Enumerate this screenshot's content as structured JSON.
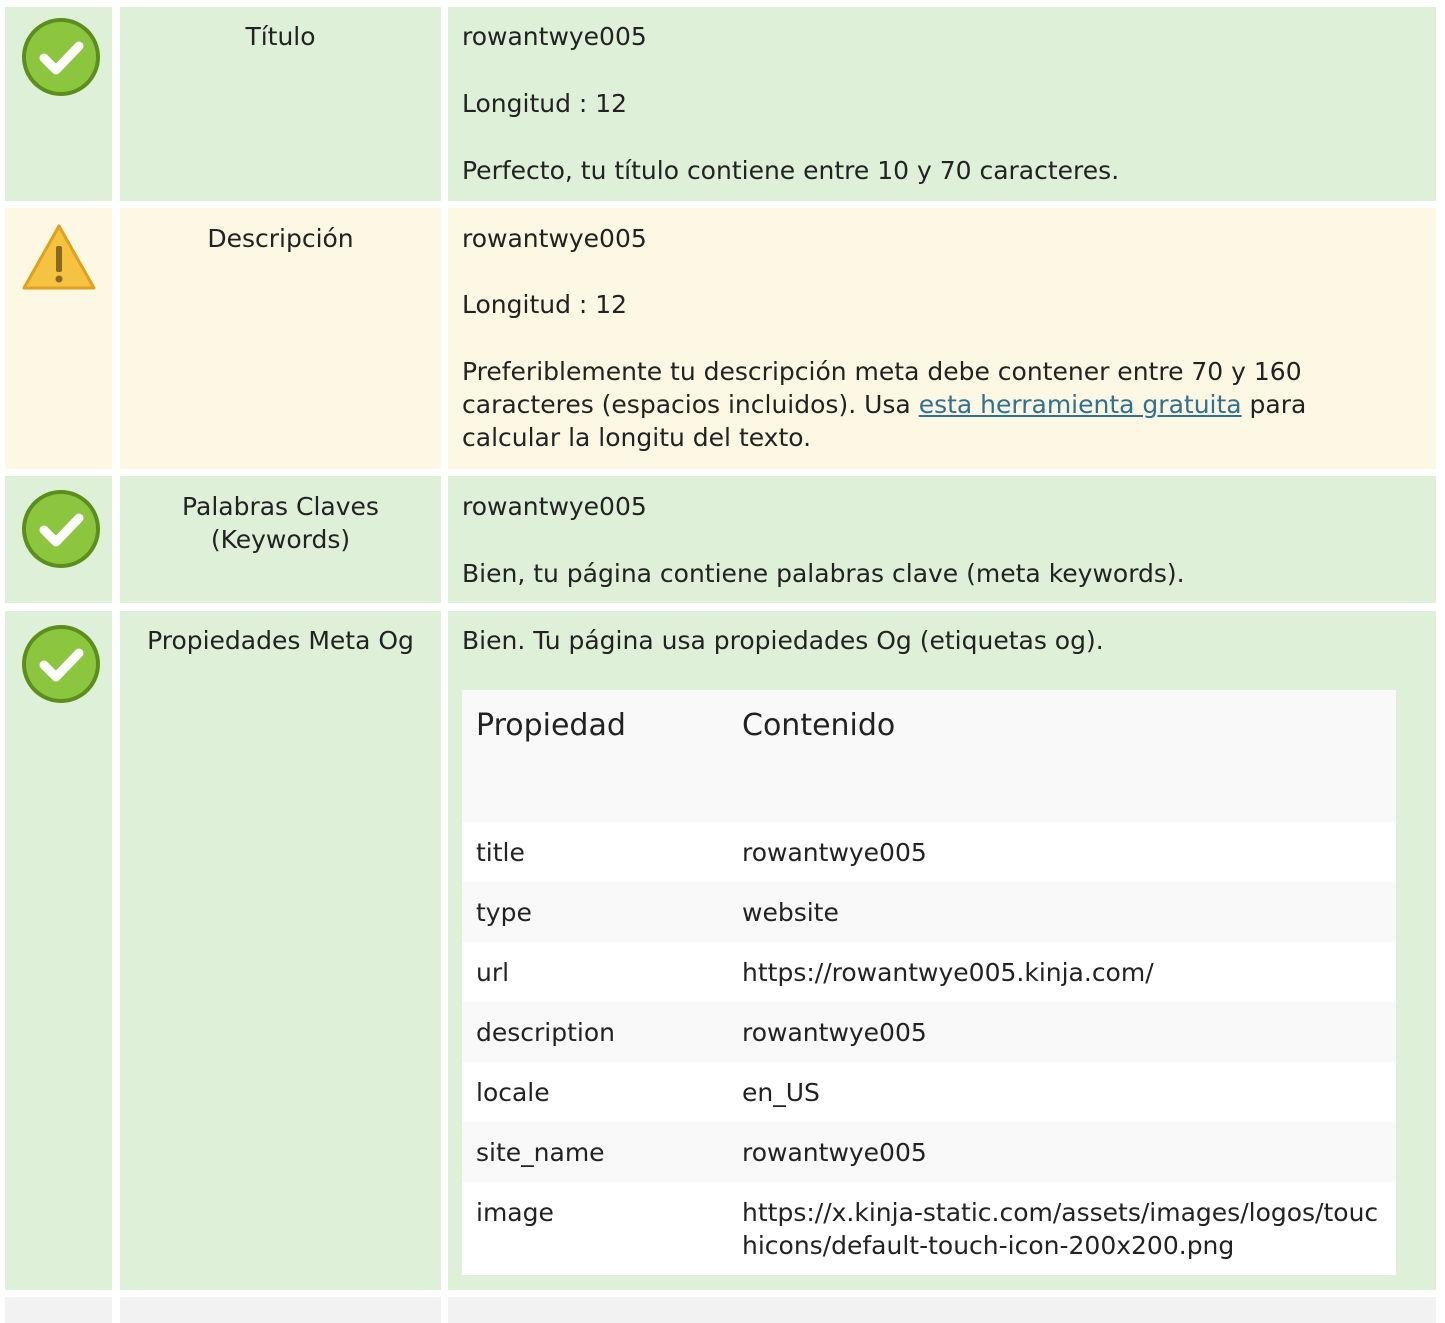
{
  "rows": [
    {
      "status": "ok",
      "label": "Título",
      "value": "rowantwye005",
      "length": "Longitud : 12",
      "message": "Perfecto, tu título contiene entre 10 y 70 caracteres."
    },
    {
      "status": "warning",
      "label": "Descripción",
      "value": "rowantwye005",
      "length": "Longitud : 12",
      "message_before": "Preferiblemente tu descripción meta debe contener entre 70 y 160 caracteres (espacios incluidos). Usa ",
      "link_text": "esta herramienta gratuita",
      "message_after": " para calcular la longitu del texto."
    },
    {
      "status": "ok",
      "label_line1": "Palabras Claves",
      "label_line2": "(Keywords)",
      "value": "rowantwye005",
      "message": "Bien, tu página contiene palabras clave (meta keywords)."
    },
    {
      "status": "ok",
      "label": "Propiedades Meta Og",
      "message": "Bien. Tu página usa propiedades Og (etiquetas og).",
      "table": {
        "header_property": "Propiedad",
        "header_content": "Contenido",
        "items": [
          {
            "property": "title",
            "content": "rowantwye005"
          },
          {
            "property": "type",
            "content": "website"
          },
          {
            "property": "url",
            "content": "https://rowantwye005.kinja.com/"
          },
          {
            "property": "description",
            "content": "rowantwye005"
          },
          {
            "property": "locale",
            "content": "en_US"
          },
          {
            "property": "site_name",
            "content": "rowantwye005"
          },
          {
            "property": "image",
            "content": "https://x.kinja-static.com/assets/images/logos/touchicons/default-touch-icon-200x200.png"
          }
        ]
      }
    }
  ],
  "colors": {
    "ok_bg": "#dff0d8",
    "warning_bg": "#fcf8e3",
    "next_bg": "#f2f2f2",
    "check_green": "#8cc63f",
    "warning_yellow": "#f5c242",
    "link": "#31708f"
  },
  "icons": {
    "ok": "check-circle-icon",
    "warning": "warning-triangle-icon"
  }
}
